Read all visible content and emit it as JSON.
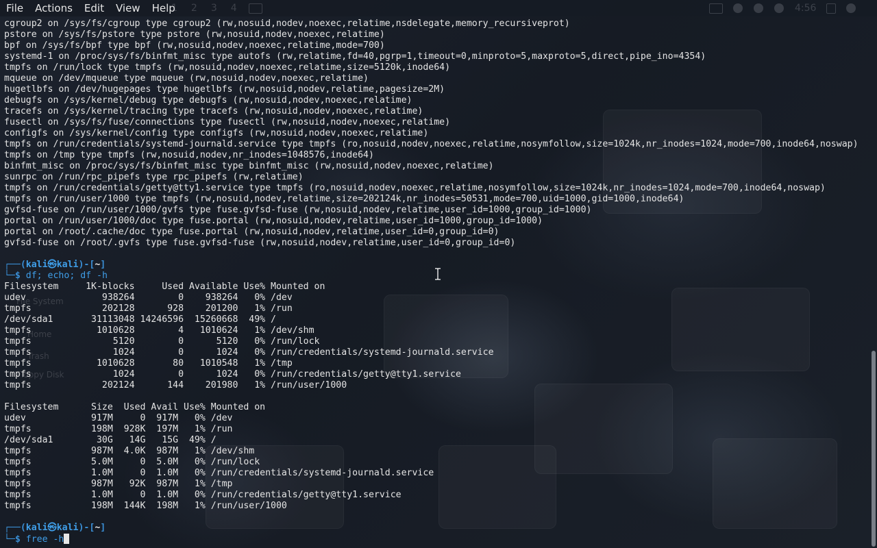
{
  "menubar": {
    "items": [
      "File",
      "Actions",
      "Edit",
      "View",
      "Help"
    ],
    "clock": "4:56"
  },
  "desktop": {
    "icon_labels": [
      "File System",
      "Home",
      "Trash",
      "Floppy Disk"
    ]
  },
  "terminal": {
    "mount_lines": [
      "cgroup2 on /sys/fs/cgroup type cgroup2 (rw,nosuid,nodev,noexec,relatime,nsdelegate,memory_recursiveprot)",
      "pstore on /sys/fs/pstore type pstore (rw,nosuid,nodev,noexec,relatime)",
      "bpf on /sys/fs/bpf type bpf (rw,nosuid,nodev,noexec,relatime,mode=700)",
      "systemd-1 on /proc/sys/fs/binfmt_misc type autofs (rw,relatime,fd=40,pgrp=1,timeout=0,minproto=5,maxproto=5,direct,pipe_ino=4354)",
      "tmpfs on /run/lock type tmpfs (rw,nosuid,nodev,noexec,relatime,size=5120k,inode64)",
      "mqueue on /dev/mqueue type mqueue (rw,nosuid,nodev,noexec,relatime)",
      "hugetlbfs on /dev/hugepages type hugetlbfs (rw,nosuid,nodev,relatime,pagesize=2M)",
      "debugfs on /sys/kernel/debug type debugfs (rw,nosuid,nodev,noexec,relatime)",
      "tracefs on /sys/kernel/tracing type tracefs (rw,nosuid,nodev,noexec,relatime)",
      "fusectl on /sys/fs/fuse/connections type fusectl (rw,nosuid,nodev,noexec,relatime)",
      "configfs on /sys/kernel/config type configfs (rw,nosuid,nodev,noexec,relatime)",
      "tmpfs on /run/credentials/systemd-journald.service type tmpfs (ro,nosuid,nodev,noexec,relatime,nosymfollow,size=1024k,nr_inodes=1024,mode=700,inode64,noswap)",
      "tmpfs on /tmp type tmpfs (rw,nosuid,nodev,nr_inodes=1048576,inode64)",
      "binfmt_misc on /proc/sys/fs/binfmt_misc type binfmt_misc (rw,nosuid,nodev,noexec,relatime)",
      "sunrpc on /run/rpc_pipefs type rpc_pipefs (rw,relatime)",
      "tmpfs on /run/credentials/getty@tty1.service type tmpfs (ro,nosuid,nodev,noexec,relatime,nosymfollow,size=1024k,nr_inodes=1024,mode=700,inode64,noswap)",
      "tmpfs on /run/user/1000 type tmpfs (rw,nosuid,nodev,relatime,size=202124k,nr_inodes=50531,mode=700,uid=1000,gid=1000,inode64)",
      "gvfsd-fuse on /run/user/1000/gvfs type fuse.gvfsd-fuse (rw,nosuid,nodev,relatime,user_id=1000,group_id=1000)",
      "portal on /run/user/1000/doc type fuse.portal (rw,nosuid,nodev,relatime,user_id=1000,group_id=1000)",
      "portal on /root/.cache/doc type fuse.portal (rw,nosuid,nodev,relatime,user_id=0,group_id=0)",
      "gvfsd-fuse on /root/.gvfs type fuse.gvfsd-fuse (rw,nosuid,nodev,relatime,user_id=0,group_id=0)"
    ],
    "prompt": {
      "frame_top_left": "┌──(",
      "user": "kali",
      "at": "㉿",
      "host": "kali",
      "mid": ")-[",
      "cwd": "~",
      "end": "]",
      "frame_bottom_left": "└─",
      "dollar": "$"
    },
    "command1": "df; echo; df -h",
    "df_lines": [
      "Filesystem     1K-blocks     Used Available Use% Mounted on",
      "udev              938264        0    938264   0% /dev",
      "tmpfs             202128      928    201200   1% /run",
      "/dev/sda1       31113048 14246596  15260668  49% /",
      "tmpfs            1010628        4   1010624   1% /dev/shm",
      "tmpfs               5120        0      5120   0% /run/lock",
      "tmpfs               1024        0      1024   0% /run/credentials/systemd-journald.service",
      "tmpfs            1010628       80   1010548   1% /tmp",
      "tmpfs               1024        0      1024   0% /run/credentials/getty@tty1.service",
      "tmpfs             202124      144    201980   1% /run/user/1000"
    ],
    "dfh_lines": [
      "Filesystem      Size  Used Avail Use% Mounted on",
      "udev            917M     0  917M   0% /dev",
      "tmpfs           198M  928K  197M   1% /run",
      "/dev/sda1        30G   14G   15G  49% /",
      "tmpfs           987M  4.0K  987M   1% /dev/shm",
      "tmpfs           5.0M     0  5.0M   0% /run/lock",
      "tmpfs           1.0M     0  1.0M   0% /run/credentials/systemd-journald.service",
      "tmpfs           987M   92K  987M   1% /tmp",
      "tmpfs           1.0M     0  1.0M   0% /run/credentials/getty@tty1.service",
      "tmpfs           198M  144K  198M   1% /run/user/1000"
    ],
    "command2_typed": "free -h"
  },
  "colors": {
    "background": "#161b24",
    "text": "#e4e4e4",
    "prompt_blue": "#3a8fd6",
    "command_blue": "#3f9ee8"
  }
}
